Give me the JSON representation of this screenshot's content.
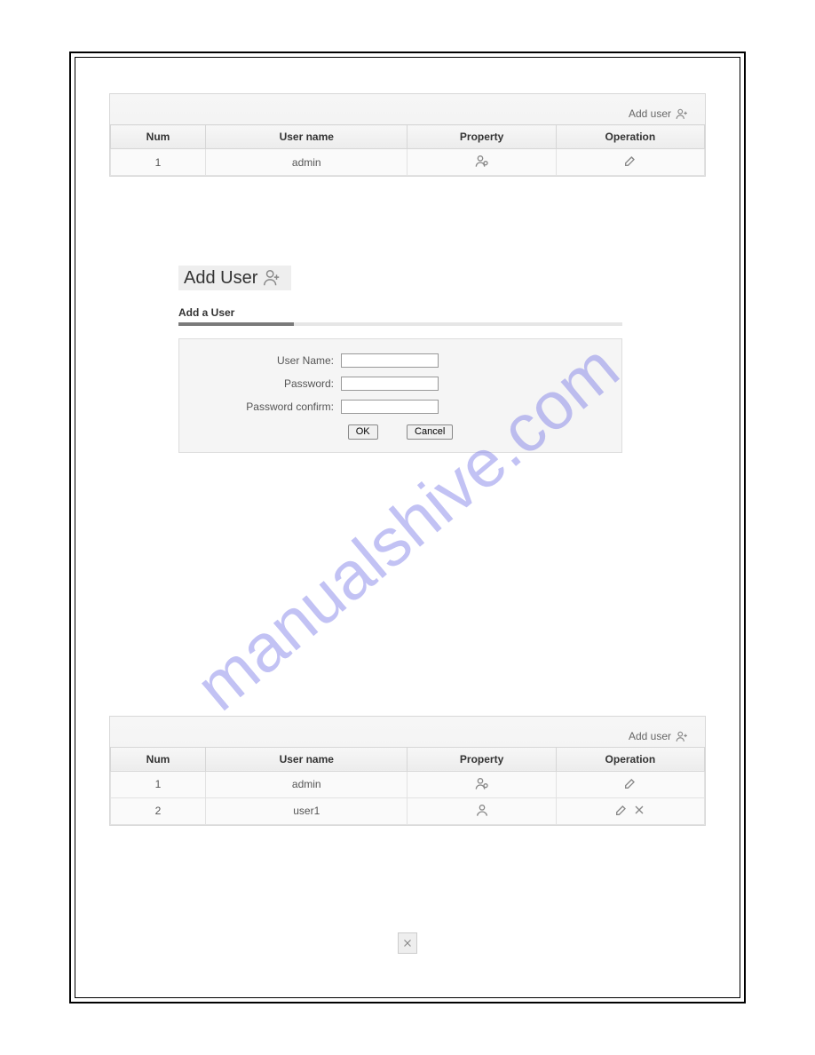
{
  "watermark": "manualshive.com",
  "table1": {
    "add_user_label": "Add user",
    "headers": {
      "num": "Num",
      "username": "User name",
      "property": "Property",
      "operation": "Operation"
    },
    "rows": [
      {
        "num": "1",
        "username": "admin"
      }
    ]
  },
  "add_user_section": {
    "heading": "Add User",
    "form_title": "Add a User",
    "labels": {
      "username": "User Name:",
      "password": "Password:",
      "password_confirm": "Password confirm:"
    },
    "buttons": {
      "ok": "OK",
      "cancel": "Cancel"
    }
  },
  "table2": {
    "add_user_label": "Add user",
    "headers": {
      "num": "Num",
      "username": "User name",
      "property": "Property",
      "operation": "Operation"
    },
    "rows": [
      {
        "num": "1",
        "username": "admin"
      },
      {
        "num": "2",
        "username": "user1"
      }
    ]
  }
}
